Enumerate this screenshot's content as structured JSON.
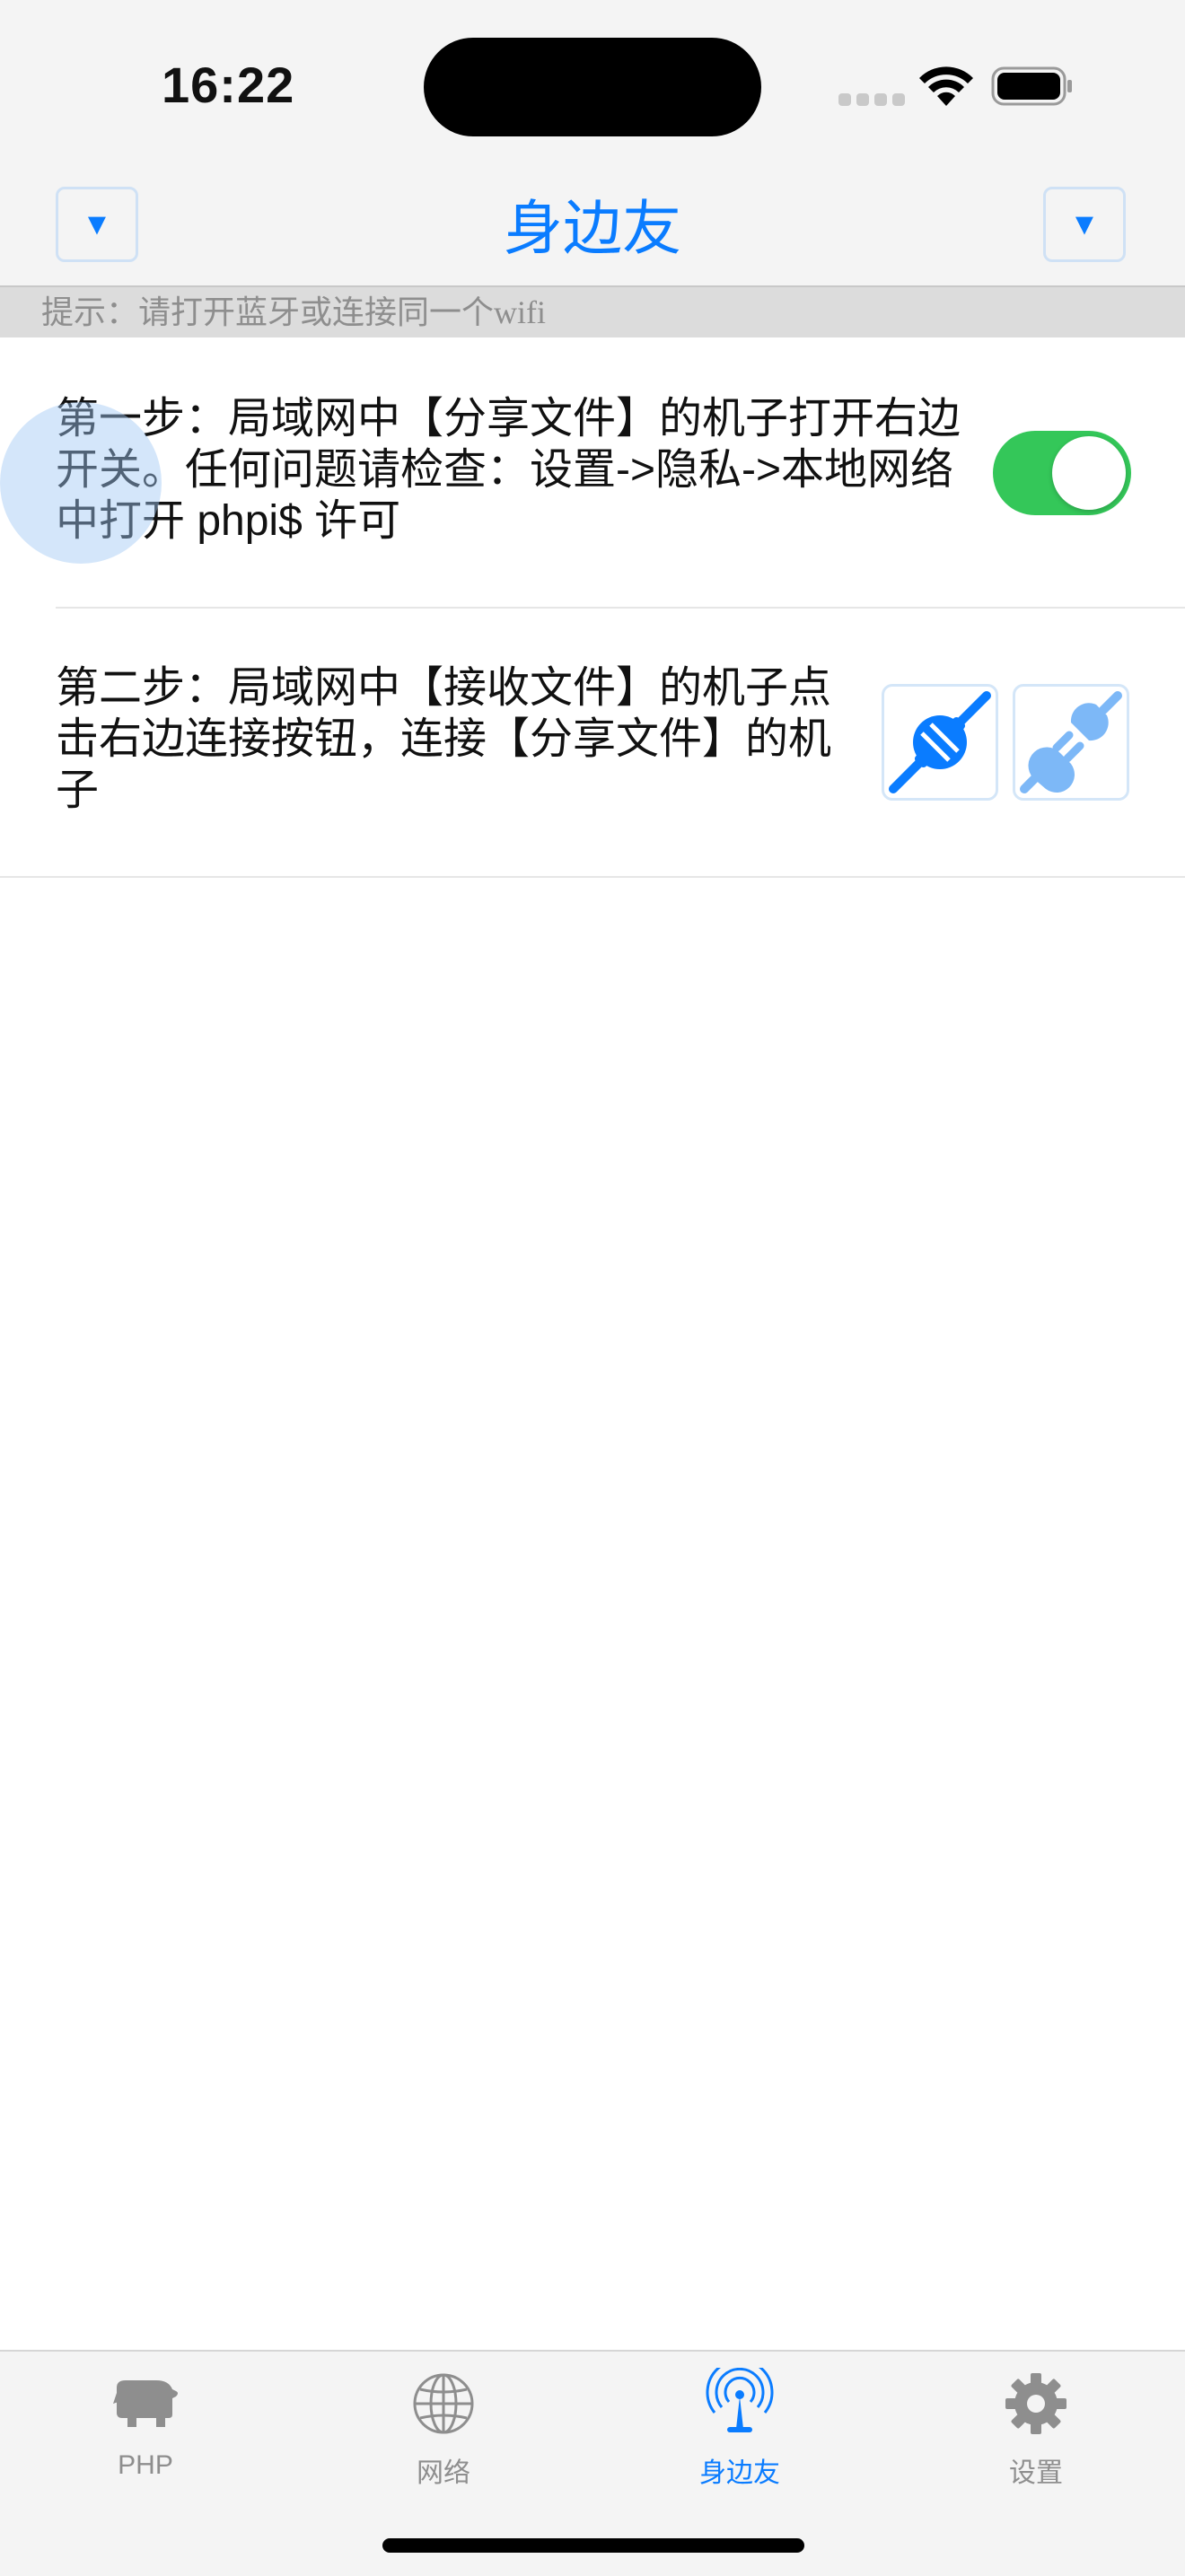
{
  "status_bar": {
    "time": "16:22"
  },
  "nav": {
    "title": "身边友",
    "left_button": "▼",
    "right_button": "▼"
  },
  "hint": "提示：请打开蓝牙或连接同一个wifi",
  "rows": [
    {
      "text": "第一步：局域网中【分享文件】的机子打开右边开关。任何问题请检查：设置->隐私->本地网络 中打开 phpi$ 许可",
      "toggle_on": true
    },
    {
      "text": "第二步：局域网中【接收文件】的机子点击右边连接按钮，连接【分享文件】的机子"
    }
  ],
  "tabs": [
    {
      "label": "PHP",
      "icon": "elephant-icon"
    },
    {
      "label": "网络",
      "icon": "globe-icon"
    },
    {
      "label": "身边友",
      "icon": "antenna-icon",
      "active": true
    },
    {
      "label": "设置",
      "icon": "gear-icon"
    }
  ],
  "colors": {
    "accent": "#0a7cff",
    "toggle_on": "#34c759",
    "hint_bg": "#dcdcdc"
  }
}
